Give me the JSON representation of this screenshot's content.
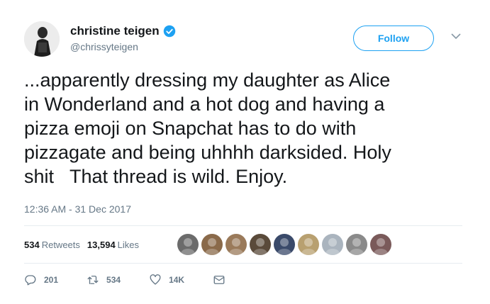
{
  "user": {
    "display_name": "christine teigen",
    "handle": "@chrissyteigen",
    "verified": true
  },
  "follow_button": {
    "label": "Follow"
  },
  "tweet": {
    "text": "...apparently dressing my daughter as Alice\nin Wonderland and a hot dog and having a\npizza emoji on Snapchat has to do with\npizzagate and being uhhhh darksided. Holy\nshit   That thread is wild. Enjoy.",
    "timestamp": "12:36 AM - 31 Dec 2017"
  },
  "stats": {
    "retweets": {
      "count": "534",
      "label": "Retweets"
    },
    "likes": {
      "count": "13,594",
      "label": "Likes"
    }
  },
  "liker_avatars": [
    "#6b6b6b",
    "#8a6a4a",
    "#9a7a5a",
    "#5a4a3a",
    "#3a4a6a",
    "#b8a070",
    "#aab4be",
    "#8a8a8a",
    "#7a5a5a"
  ],
  "actions": {
    "reply_count": "201",
    "retweet_count": "534",
    "like_count": "14K"
  },
  "colors": {
    "accent": "#1da1f2",
    "secondary_text": "#657786",
    "divider": "#e6ecf0"
  }
}
